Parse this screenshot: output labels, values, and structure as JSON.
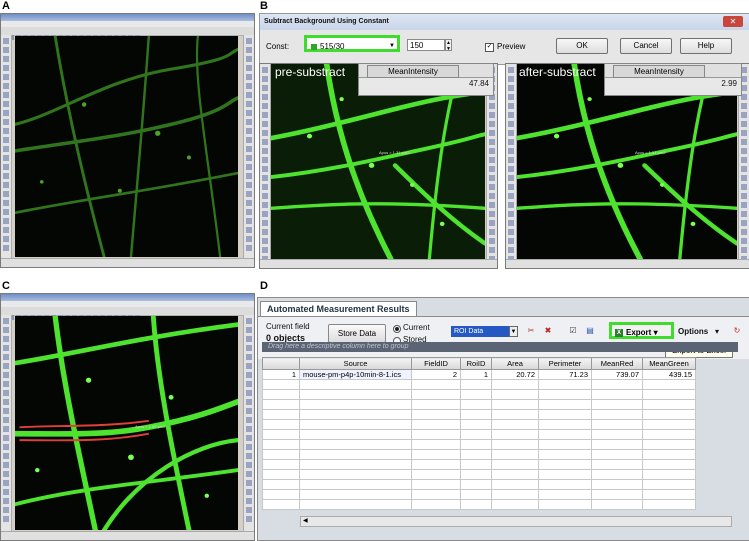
{
  "panels": {
    "a": {
      "label": "A"
    },
    "b": {
      "label": "B"
    },
    "c": {
      "label": "C"
    },
    "d": {
      "label": "D"
    }
  },
  "dialog": {
    "title": "Subtract Background Using Constant",
    "close_glyph": "✕",
    "const_label": "Const:",
    "const_value": "515/30",
    "number_value": "150",
    "preview_label": "Preview",
    "preview_checked": true,
    "ok_label": "OK",
    "cancel_label": "Cancel",
    "help_label": "Help"
  },
  "pre": {
    "label": "pre-substract",
    "header": "MeanIntensity",
    "value": "47.84"
  },
  "post": {
    "label": "after-substract",
    "header": "MeanIntensity",
    "value": "2.99"
  },
  "measure": {
    "tab": "Automated Measurement Results",
    "current_field_label": "Current field",
    "objects_label": "0 objects",
    "store_button": "Store Data",
    "radio_current": "Current",
    "radio_stored": "Stored",
    "roi_select": "ROI Data",
    "export_label": "Export",
    "options_label": "Options",
    "tooltip": "Export to Excel",
    "group_hint": "Drag here a descriptive column here to group",
    "columns": [
      "Source",
      "FieldID",
      "RoiID",
      "Area",
      "Perimeter",
      "MeanRed",
      "MeanGreen"
    ],
    "rows": [
      {
        "num": "1",
        "source": "mouse-pm-p4p-10min-8-1.ics",
        "fieldid": "2",
        "roiid": "1",
        "area": "20.72",
        "perimeter": "71.23",
        "meanred": "739.07",
        "meangreen": "439.15"
      }
    ]
  },
  "colors": {
    "highlight": "#3fdc2e",
    "fluorescence": "#5dff3a",
    "background": "#030603"
  }
}
